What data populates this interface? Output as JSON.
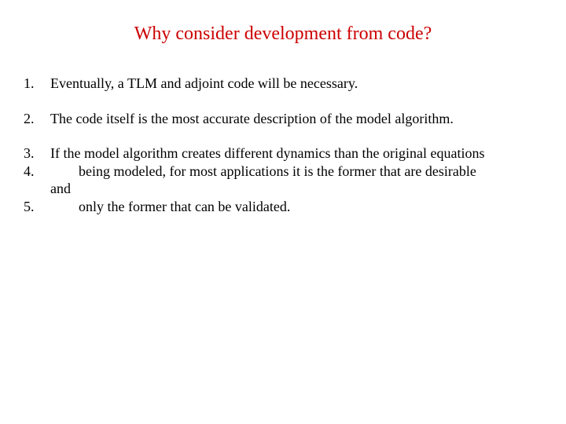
{
  "title": "Why consider development from code?",
  "items": {
    "n1": "1.",
    "t1": "Eventually, a TLM and adjoint code will be necessary.",
    "n2": "2.",
    "t2": "The code itself is the most accurate description of the model algorithm.",
    "n3": "3.",
    "t3": "If the model algorithm creates different dynamics than the original equations",
    "n4": "4.",
    "t4": "being modeled, for most applications it is the former that are desirable",
    "t4b": "and",
    "n5": "5.",
    "t5": "only the former that can be validated."
  }
}
